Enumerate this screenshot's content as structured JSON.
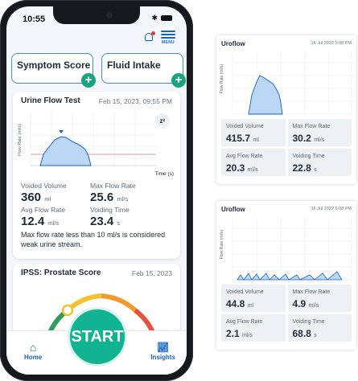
{
  "phone": {
    "status_time": "10:55",
    "menu_label": "MENU",
    "tiles": [
      {
        "title": "Symptom Score"
      },
      {
        "title": "Fluid Intake"
      }
    ],
    "urine_card": {
      "title": "Urine Flow Test",
      "date": "Feb 15, 2023, 09:55 PM",
      "y_label": "Flow Rate (ml/s)",
      "x_label": "Time (s)",
      "metrics": [
        {
          "label": "Voided Volume",
          "value": "360",
          "unit": "ml"
        },
        {
          "label": "Max Flow Rate",
          "value": "25.6",
          "unit": "ml/s"
        },
        {
          "label": "Avg Flow Rate",
          "value": "12.4",
          "unit": "ml/s"
        },
        {
          "label": "Voiding Time",
          "value": "23.4",
          "unit": "s"
        }
      ],
      "note": "Max flow rate less than 10 ml/s is considered weak urine stream."
    },
    "ipss_card": {
      "title": "IPSS: Prostate Score",
      "date": "Feb 15, 2023"
    },
    "nav": {
      "home": "Home",
      "start": "START",
      "insights": "Insights"
    },
    "colors": {
      "accent": "#1565c0",
      "start": "#12b393",
      "chart_fill": "#bcd6f5",
      "threshold": "#e57373"
    }
  },
  "panels": [
    {
      "title": "Uroflow",
      "date": "16 Jul 2022   5:08 PM",
      "y_label": "Flow Rate (ml/s)",
      "metrics": [
        {
          "label": "Voided Volume",
          "value": "415.7",
          "unit": "ml"
        },
        {
          "label": "Max Flow Rate",
          "value": "30.2",
          "unit": "ml/s"
        },
        {
          "label": "Avg Flow Rate",
          "value": "20.3",
          "unit": "ml/s"
        },
        {
          "label": "Voiding Time",
          "value": "22.8",
          "unit": "s"
        }
      ]
    },
    {
      "title": "Uroflow",
      "date": "16 Jul 2022   5:08 PM",
      "y_label": "Flow Rate (ml/s)",
      "metrics": [
        {
          "label": "Voided Volume",
          "value": "44.8",
          "unit": "ml"
        },
        {
          "label": "Max Flow Rate",
          "value": "4.9",
          "unit": "ml/s"
        },
        {
          "label": "Avg Flow Rate",
          "value": "2.1",
          "unit": "ml/s"
        },
        {
          "label": "Voiding Time",
          "value": "68.8",
          "unit": "s"
        }
      ]
    }
  ]
}
